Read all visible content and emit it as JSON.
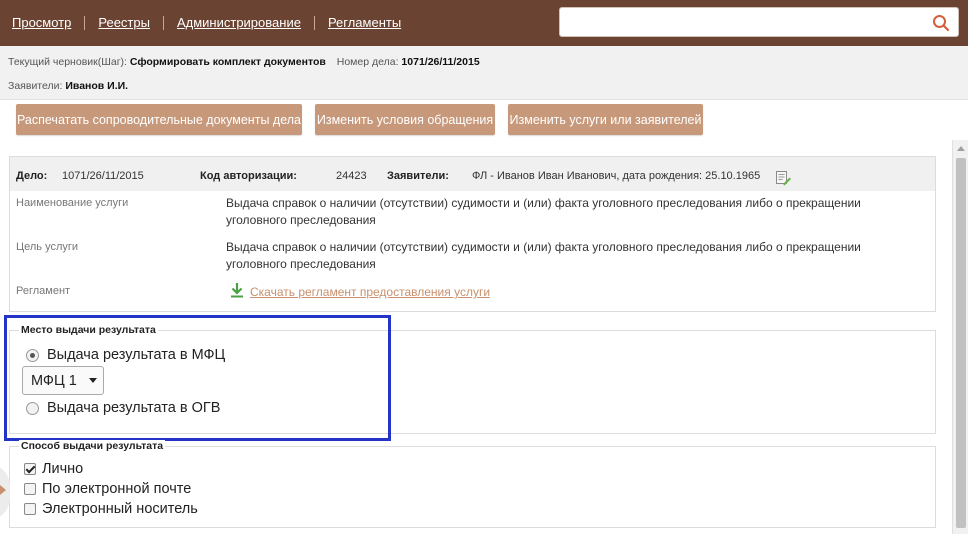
{
  "nav": {
    "items": [
      "Просмотр",
      "Реестры",
      "Администрирование",
      "Регламенты"
    ]
  },
  "search": {
    "value": "",
    "placeholder": ""
  },
  "info": {
    "draft_label": "Текущий черновик(Шаг):",
    "draft_value": "Сформировать комплект документов",
    "case_no_label": "Номер дела:",
    "case_no_value": "1071/26/11/2015",
    "applicants_label": "Заявители:",
    "applicants_value": "Иванов И.И."
  },
  "actions": {
    "print": "Распечатать сопроводительные документы дела",
    "change_conditions": "Изменить условия обращения",
    "change_services": "Изменить услуги или заявителей"
  },
  "case": {
    "case_label": "Дело:",
    "case_value": "1071/26/11/2015",
    "auth_label": "Код авторизации:",
    "auth_value": "24423",
    "applicants_label": "Заявители:",
    "applicants_value": "ФЛ - Иванов Иван Иванович, дата рождения: 25.10.1965",
    "service_name_label": "Наименование услуги",
    "service_name_value": "Выдача справок о наличии (отсутствии) судимости и (или) факта уголовного преследования либо о прекращении уголовного преследования",
    "service_goal_label": "Цель услуги",
    "service_goal_value": "Выдача справок о наличии (отсутствии) судимости и (или) факта уголовного преследования либо о прекращении уголовного преследования",
    "regulation_label": "Регламент",
    "regulation_link": "Скачать регламент предоставления услуги"
  },
  "place": {
    "legend": "Место выдачи результата",
    "option_mfc": "Выдача результата в МФЦ",
    "option_ogv": "Выдача результата в ОГВ",
    "selected": "mfc",
    "mfc_select_value": "МФЦ 1"
  },
  "method": {
    "legend": "Способ выдачи результата",
    "options": [
      {
        "label": "Лично",
        "checked": true
      },
      {
        "label": "По электронной почте",
        "checked": false
      },
      {
        "label": "Электронный носитель",
        "checked": false
      }
    ]
  },
  "colors": {
    "topbar": "#6b4332",
    "button": "#c8987a",
    "link": "#c8906c",
    "highlight": "#2434c8"
  }
}
